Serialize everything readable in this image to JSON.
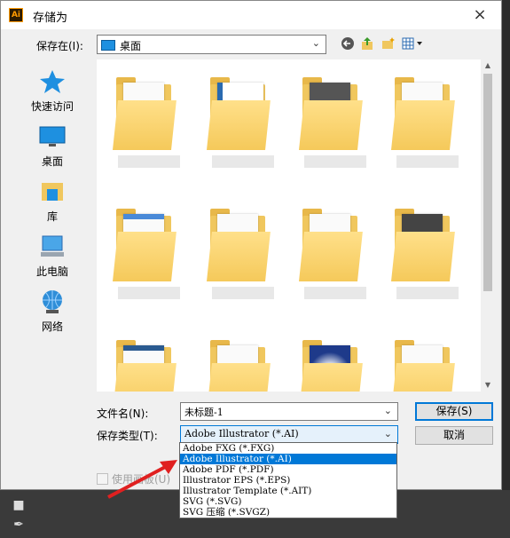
{
  "window": {
    "title": "存储为",
    "app_icon": "Ai",
    "close": "×"
  },
  "location": {
    "label": "保存在(I):",
    "value": "桌面"
  },
  "toolbar": {
    "back_icon": "back-arrow-icon",
    "up_icon": "up-folder-icon",
    "new_folder_icon": "new-folder-icon",
    "view_icon": "view-menu-icon"
  },
  "places": [
    {
      "label": "快速访问",
      "icon": "star-icon"
    },
    {
      "label": "桌面",
      "icon": "desktop-icon"
    },
    {
      "label": "库",
      "icon": "library-icon"
    },
    {
      "label": "此电脑",
      "icon": "computer-icon"
    },
    {
      "label": "网络",
      "icon": "network-icon"
    }
  ],
  "filename": {
    "label": "文件名(N):",
    "value": "未标题-1"
  },
  "filetype": {
    "label": "保存类型(T):",
    "value": "Adobe Illustrator (*.AI)",
    "options": [
      "Adobe FXG (*.FXG)",
      "Adobe Illustrator (*.AI)",
      "Adobe PDF (*.PDF)",
      "Illustrator EPS (*.EPS)",
      "Illustrator Template (*.AIT)",
      "SVG (*.SVG)",
      "SVG 压缩 (*.SVGZ)"
    ],
    "selected_index": 1
  },
  "buttons": {
    "save": "保存(S)",
    "cancel": "取消"
  },
  "checkbox": {
    "label": "使用画板(U)"
  },
  "colors": {
    "accent": "#0078d7",
    "folder": "#f5c95a",
    "annotation_arrow": "#e02020"
  }
}
